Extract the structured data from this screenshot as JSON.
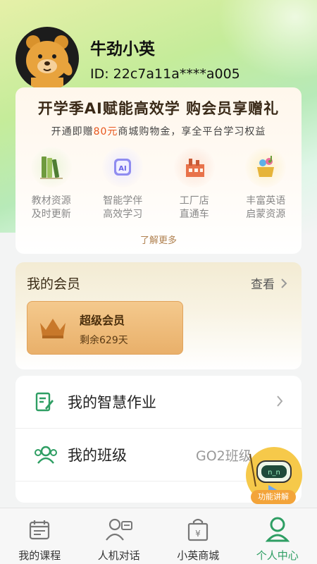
{
  "user": {
    "name": "牛劲小英",
    "id": "ID: 22c7a11a****a005"
  },
  "promo": {
    "title": "开学季AI赋能高效学 购会员享赠礼",
    "subtitle_before": "开通即赠",
    "subtitle_highlight": "80元",
    "subtitle_after": "商城购物金，享全平台学习权益",
    "features": [
      {
        "icon": "books-icon",
        "line1": "教材资源",
        "line2": "及时更新"
      },
      {
        "icon": "ai-robot-icon",
        "line1": "智能学伴",
        "line2": "高效学习"
      },
      {
        "icon": "factory-icon",
        "line1": "工厂店",
        "line2": "直通车"
      },
      {
        "icon": "music-basket-icon",
        "line1": "丰富英语",
        "line2": "启蒙资源"
      }
    ],
    "learn_more": "了解更多"
  },
  "member": {
    "title": "我的会员",
    "view": "查看",
    "card_name": "超级会员",
    "card_days": "剩余629天"
  },
  "menu": {
    "homework": "我的智慧作业",
    "class_label": "我的班级",
    "class_value": "GO2班级"
  },
  "float_button": {
    "label": "功能讲解"
  },
  "tabs": [
    {
      "label": "我的课程",
      "icon": "calendar-icon"
    },
    {
      "label": "人机对话",
      "icon": "chat-person-icon"
    },
    {
      "label": "小英商城",
      "icon": "shopping-bag-icon"
    },
    {
      "label": "个人中心",
      "icon": "person-icon"
    }
  ],
  "colors": {
    "accent": "#2e9e63",
    "promo_highlight": "#e8561c",
    "vip_gold": "#e9b06a"
  }
}
